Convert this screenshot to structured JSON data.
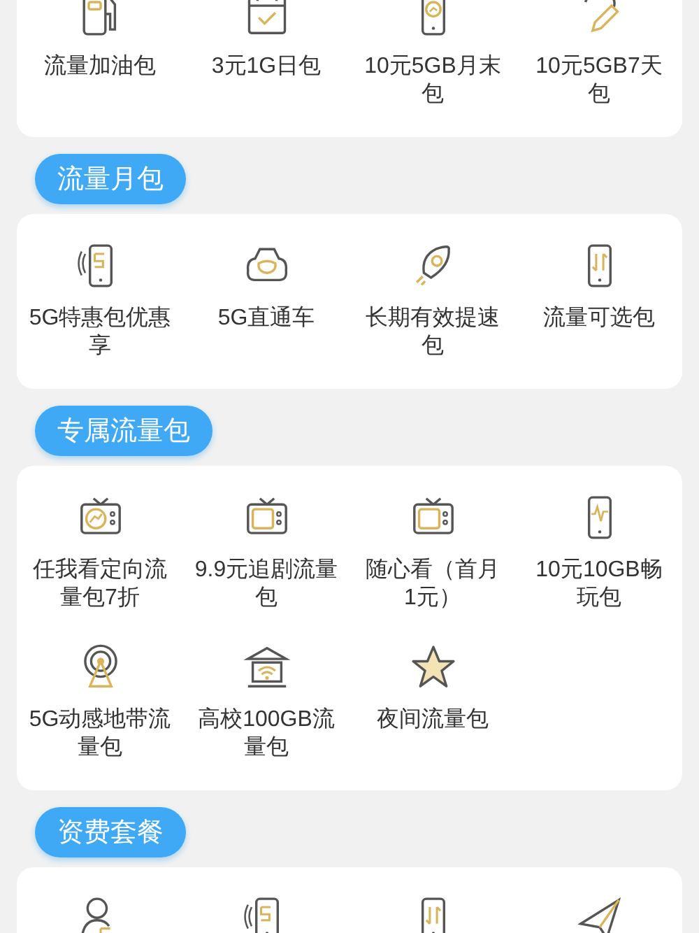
{
  "sections": [
    {
      "items": [
        {
          "kind": "fuel",
          "label": "流量加油包"
        },
        {
          "kind": "calendar",
          "label": "3元1G日包"
        },
        {
          "kind": "phone_coin",
          "label": "10元5GB月末包"
        },
        {
          "kind": "pencil",
          "label": "10元5GB7天包"
        }
      ]
    },
    {
      "title": "流量月包",
      "items": [
        {
          "kind": "phone_5g",
          "label": "5G特惠包优惠享"
        },
        {
          "kind": "car_5g",
          "label": "5G直通车"
        },
        {
          "kind": "rocket",
          "label": "长期有效提速包"
        },
        {
          "kind": "phone_arrows",
          "label": "流量可选包"
        }
      ]
    },
    {
      "title": "专属流量包",
      "items": [
        {
          "kind": "tv_chart",
          "label": "任我看定向流量包7折"
        },
        {
          "kind": "tv",
          "label": "9.9元追剧流量包"
        },
        {
          "kind": "tv",
          "label": "随心看（首月1元）"
        },
        {
          "kind": "phone_wave",
          "label": "10元10GB畅玩包"
        },
        {
          "kind": "antenna",
          "label": "5G动感地带流量包"
        },
        {
          "kind": "school",
          "label": "高校100GB流量包"
        },
        {
          "kind": "star",
          "label": "夜间流量包"
        }
      ]
    },
    {
      "title": "资费套餐",
      "items": [
        {
          "kind": "person_5g"
        },
        {
          "kind": "phone_5g"
        },
        {
          "kind": "phone_arrows"
        },
        {
          "kind": "plane"
        }
      ]
    }
  ]
}
